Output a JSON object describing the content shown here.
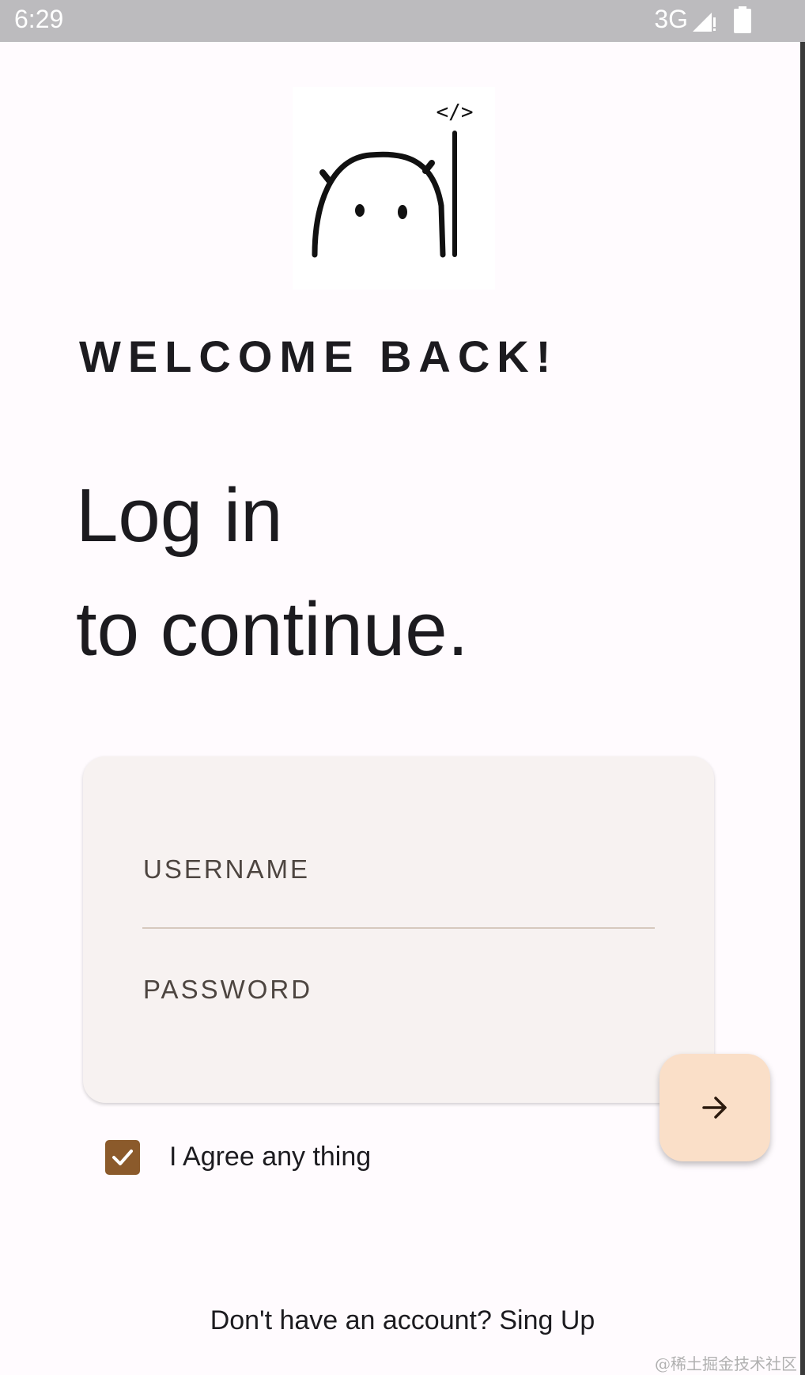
{
  "status_bar": {
    "time": "6:29",
    "network": "3G",
    "signal_icon": "signal-icon",
    "battery_icon": "battery-icon"
  },
  "logo": {
    "icon": "ghost-coder-logo",
    "code_glyph": "</>"
  },
  "welcome": "WELCOME BACK!",
  "headline": {
    "line1": "Log in",
    "line2": "to continue."
  },
  "form": {
    "username_label": "USERNAME",
    "password_label": "PASSWORD",
    "submit_icon": "arrow-right-icon"
  },
  "agree": {
    "checked": true,
    "label": "I Agree any thing"
  },
  "signup": {
    "text": "Don't have an account? Sing Up"
  },
  "watermark": "@稀土掘金技术社区",
  "colors": {
    "background": "#fffbfe",
    "card": "#f7f2f1",
    "fab": "#fadfc8",
    "checkbox": "#8b5a2b",
    "status_bar": "#bcbbbe"
  }
}
